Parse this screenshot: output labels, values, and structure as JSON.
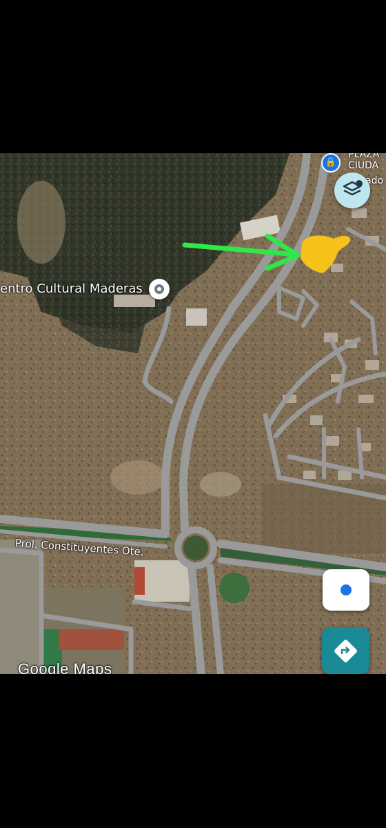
{
  "map": {
    "poi": {
      "label": "entro Cultural Maderas"
    },
    "street": {
      "label": "Prol. Constituyentes Ote."
    },
    "corner_labels": {
      "line1": "PLAZA",
      "line2": "CIUDA",
      "line3": "ado"
    },
    "attribution": "Google Maps"
  },
  "annotations": {
    "arrow_color": "#2ee84a",
    "highlight_color": "#f6c21a"
  },
  "controls": {
    "layers_icon": "layers-icon",
    "locate_icon": "my-location-icon",
    "directions_icon": "directions-icon",
    "accent": "#1a73e8",
    "directions_bg": "#1a8a96"
  }
}
